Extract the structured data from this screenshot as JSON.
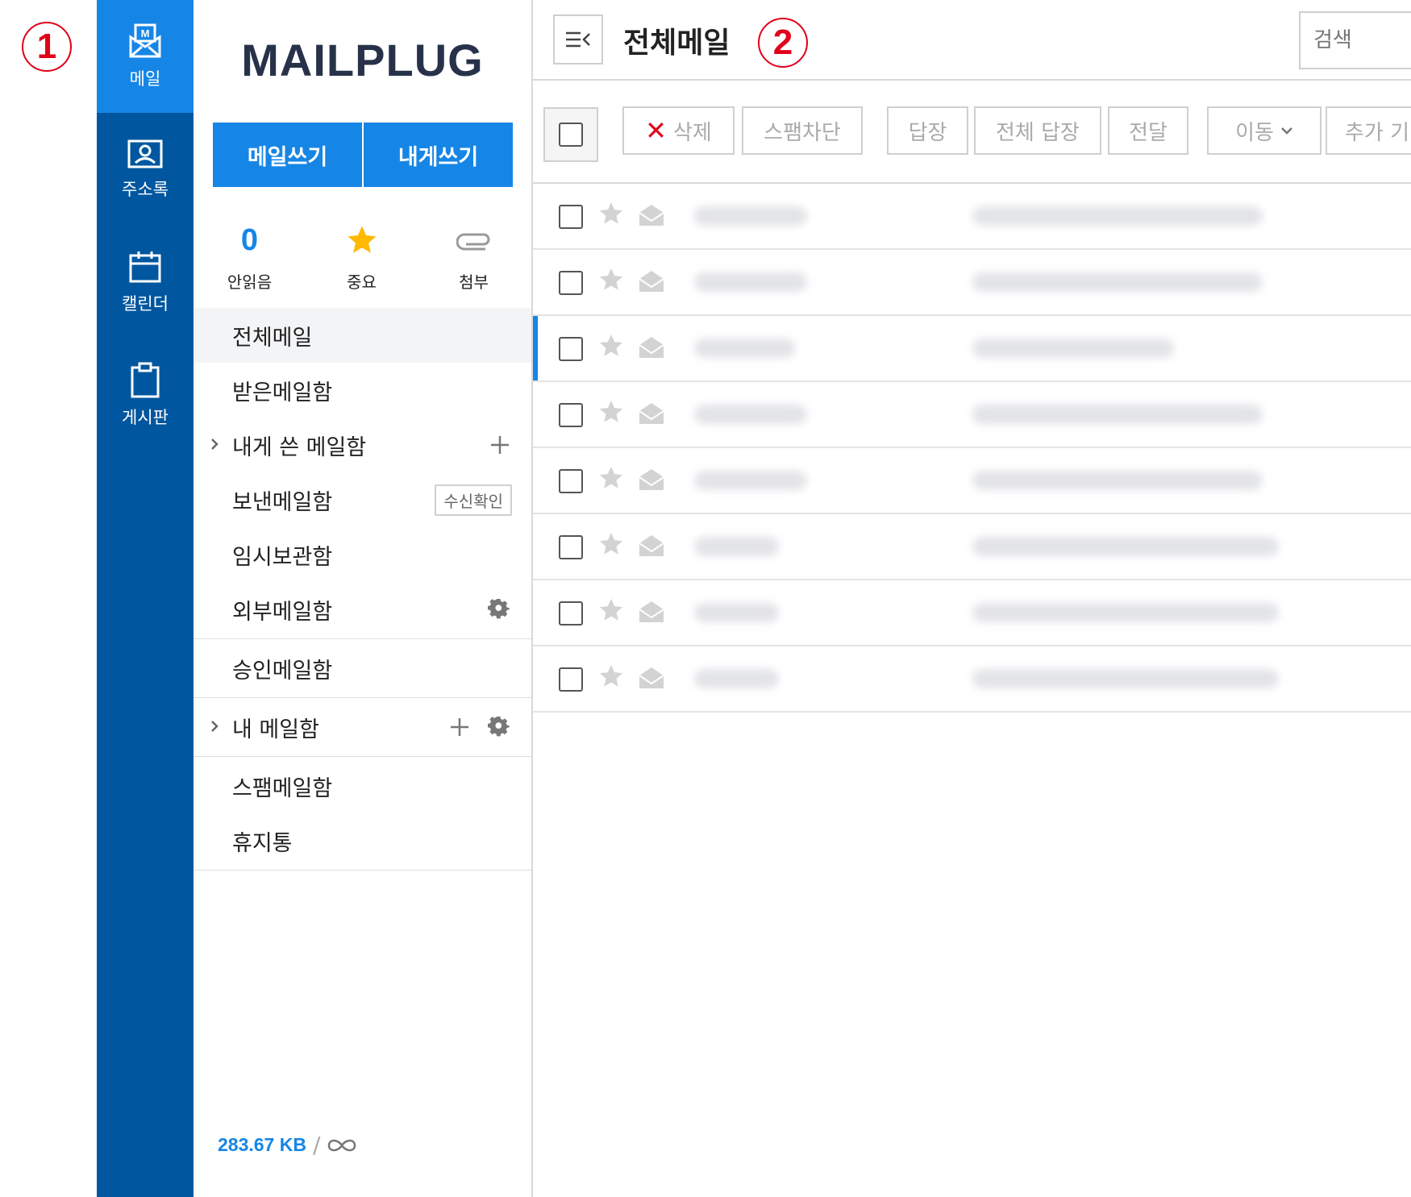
{
  "annotations": [
    "1",
    "2"
  ],
  "rail": {
    "items": [
      {
        "label": "메일",
        "icon": "mail-icon",
        "active": true
      },
      {
        "label": "주소록",
        "icon": "contact-card-icon",
        "active": false
      },
      {
        "label": "캘린더",
        "icon": "calendar-icon",
        "active": false
      },
      {
        "label": "게시판",
        "icon": "clipboard-icon",
        "active": false
      }
    ]
  },
  "sidebar": {
    "logo": "MAILPLUG",
    "write_mail": "메일쓰기",
    "write_self": "내게쓰기",
    "quick": {
      "unread_count": "0",
      "unread_label": "안읽음",
      "important_label": "중요",
      "attachment_label": "첨부"
    },
    "folders": {
      "all": "전체메일",
      "inbox": "받은메일함",
      "self": "내게 쓴 메일함",
      "sent": "보낸메일함",
      "sent_badge": "수신확인",
      "drafts": "임시보관함",
      "external": "외부메일함",
      "approval": "승인메일함",
      "my": "내 메일함",
      "spam": "스팸메일함",
      "trash": "휴지통"
    },
    "storage": {
      "used": "283.67 KB",
      "separator": "/",
      "total_icon": "infinity-icon"
    }
  },
  "main": {
    "title": "전체메일",
    "search_placeholder": "검색",
    "toolbar": {
      "delete": "삭제",
      "block_spam": "스팸차단",
      "reply": "답장",
      "reply_all": "전체 답장",
      "forward": "전달",
      "move": "이동",
      "more": "추가 기"
    },
    "row_count": 8,
    "current_row_index": 2
  },
  "colors": {
    "rail_bg": "#00579f",
    "rail_active": "#1686e6",
    "accent": "#1686e6",
    "annotation_red": "#e0001a",
    "logo": "#27324a"
  }
}
